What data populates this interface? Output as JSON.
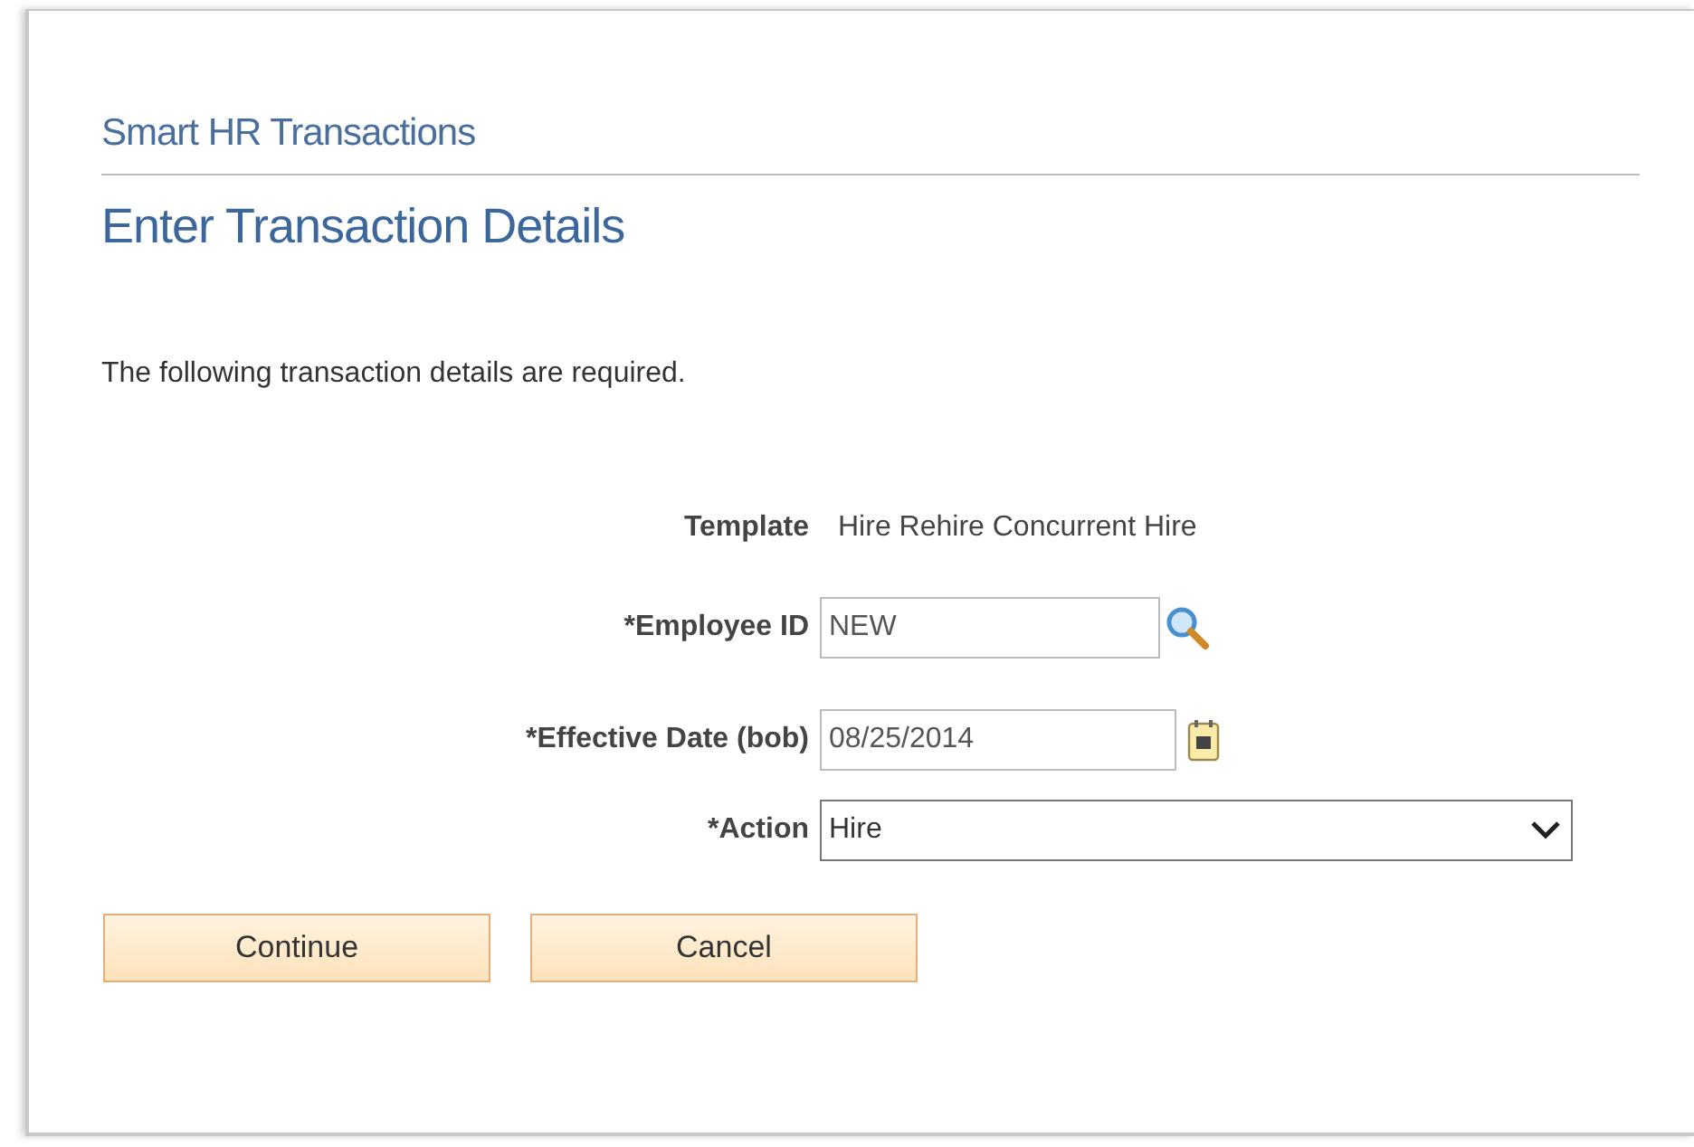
{
  "breadcrumb": "Smart HR Transactions",
  "title": "Enter Transaction Details",
  "instructions": "The following transaction details are required.",
  "fields": [
    {
      "kind": "text",
      "label": "Template",
      "value": "Hire Rehire Concurrent Hire"
    },
    {
      "kind": "lookup",
      "label": "*Employee ID",
      "value": "NEW"
    },
    {
      "kind": "date",
      "label": "*Effective Date (bob)",
      "value": "08/25/2014"
    },
    {
      "kind": "select",
      "label": "*Action",
      "value": "Hire"
    }
  ],
  "buttons": [
    "Continue",
    "Cancel"
  ]
}
